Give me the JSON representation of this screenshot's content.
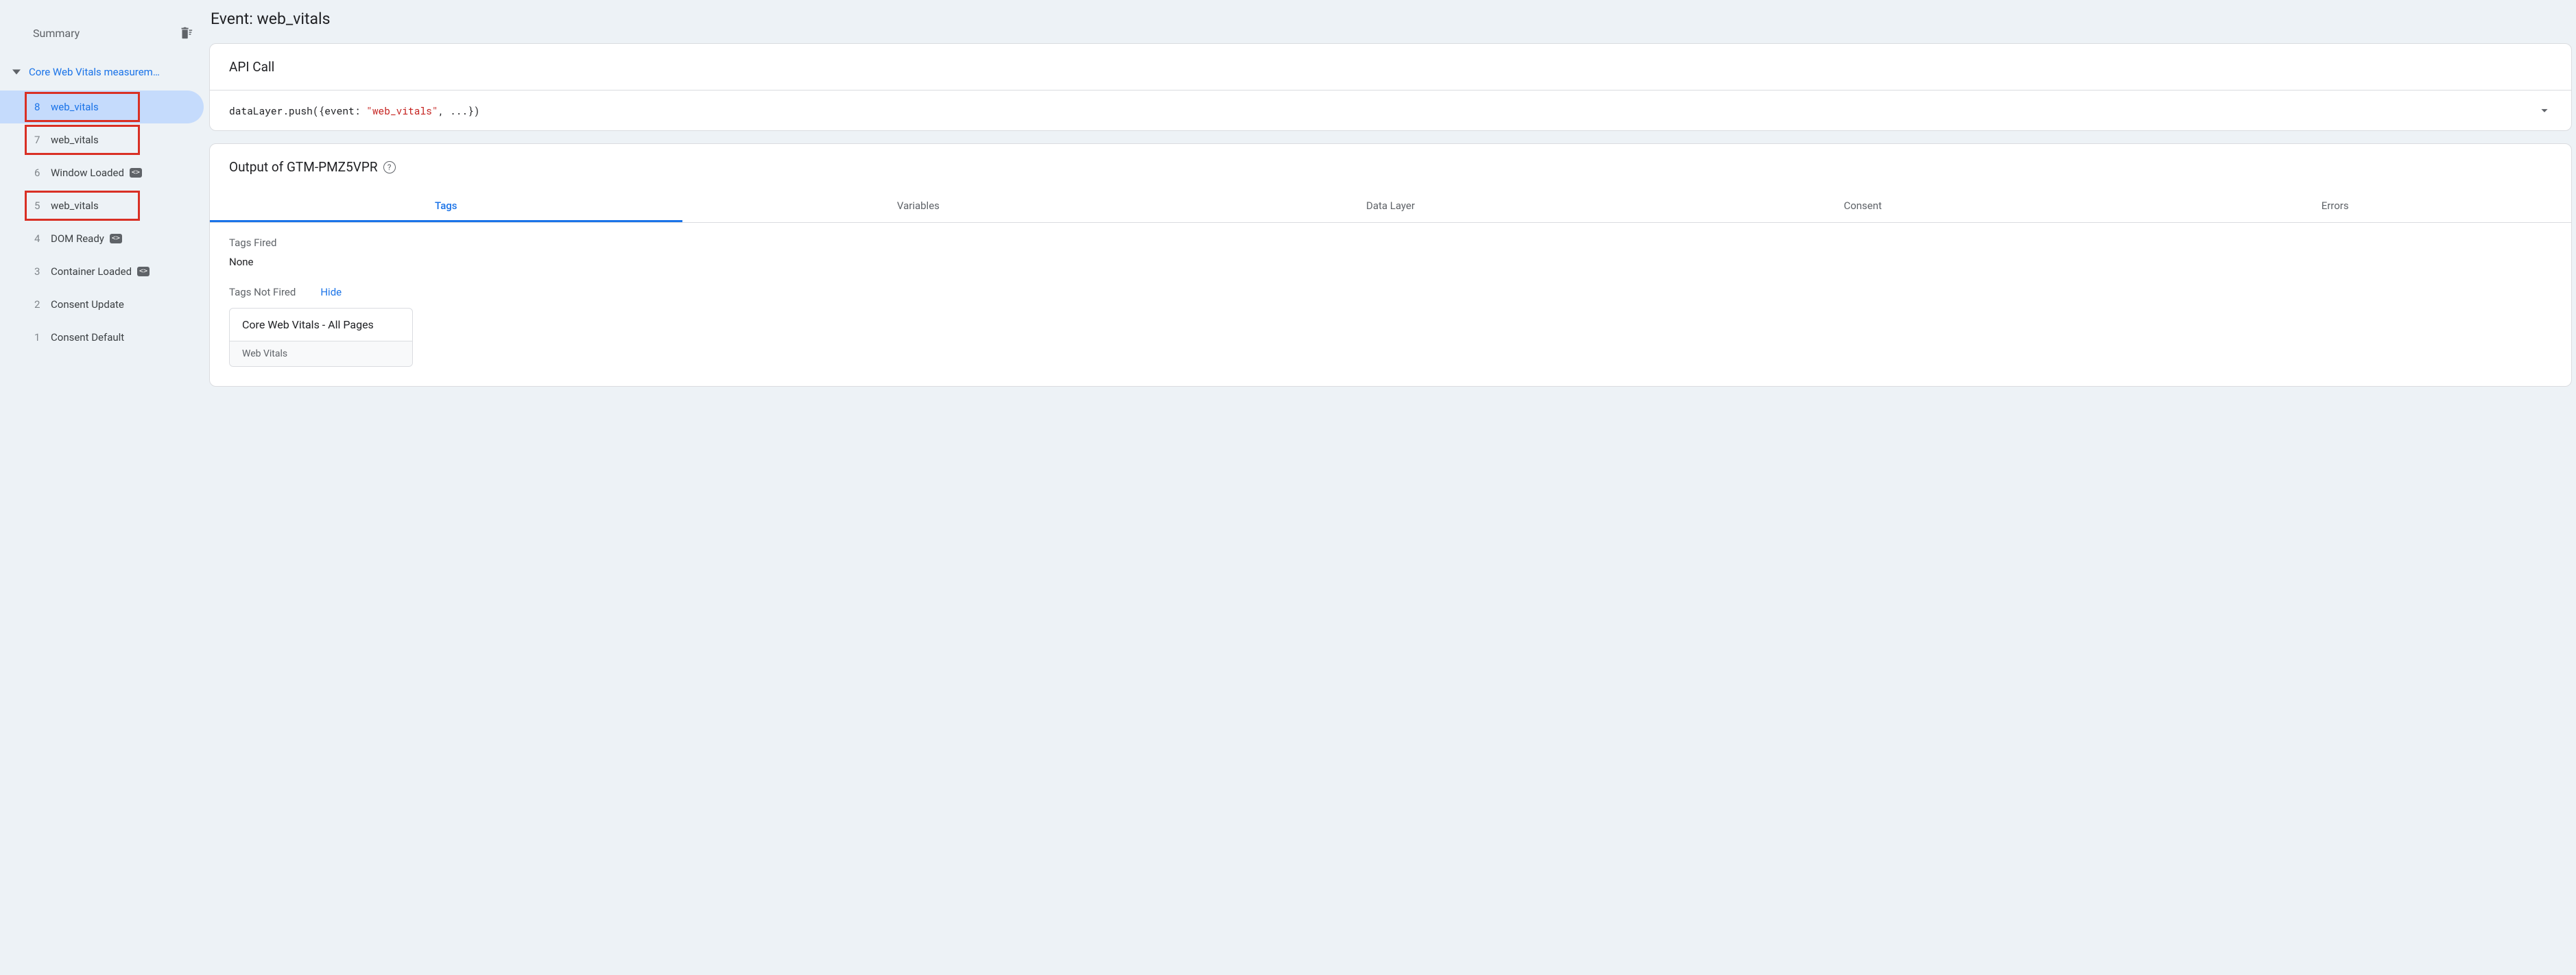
{
  "sidebar": {
    "summary_label": "Summary",
    "root_label": "Core Web Vitals measurem…",
    "events": [
      {
        "index": "8",
        "name": "web_vitals",
        "selected": true,
        "highlight": true,
        "badge": false
      },
      {
        "index": "7",
        "name": "web_vitals",
        "selected": false,
        "highlight": true,
        "badge": false
      },
      {
        "index": "6",
        "name": "Window Loaded",
        "selected": false,
        "highlight": false,
        "badge": true
      },
      {
        "index": "5",
        "name": "web_vitals",
        "selected": false,
        "highlight": true,
        "badge": false
      },
      {
        "index": "4",
        "name": "DOM Ready",
        "selected": false,
        "highlight": false,
        "badge": true
      },
      {
        "index": "3",
        "name": "Container Loaded",
        "selected": false,
        "highlight": false,
        "badge": true
      },
      {
        "index": "2",
        "name": "Consent Update",
        "selected": false,
        "highlight": false,
        "badge": false
      },
      {
        "index": "1",
        "name": "Consent Default",
        "selected": false,
        "highlight": false,
        "badge": false
      }
    ]
  },
  "main": {
    "title": "Event: web_vitals",
    "api_call": {
      "header": "API Call",
      "code_prefix": "dataLayer.push({event: ",
      "code_string": "\"web_vitals\"",
      "code_suffix": ", ...})"
    },
    "output": {
      "header": "Output of GTM-PMZ5VPR",
      "tabs": [
        "Tags",
        "Variables",
        "Data Layer",
        "Consent",
        "Errors"
      ],
      "active_tab": 0,
      "tags_fired_label": "Tags Fired",
      "tags_fired_value": "None",
      "tags_not_fired_label": "Tags Not Fired",
      "hide_label": "Hide",
      "not_fired": [
        {
          "title": "Core Web Vitals - All Pages",
          "type": "Web Vitals"
        }
      ]
    }
  }
}
